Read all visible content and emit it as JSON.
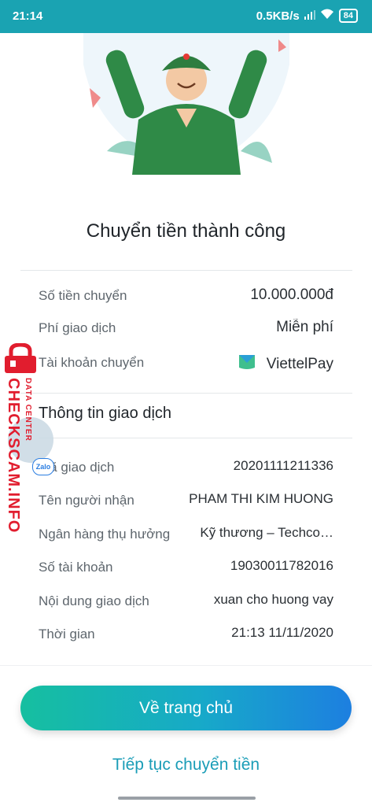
{
  "status_bar": {
    "time": "21:14",
    "network_speed": "0.5KB/s",
    "battery": "84"
  },
  "title": "Chuyển tiền thành công",
  "summary": [
    {
      "label": "Số tiền chuyển",
      "value": "10.000.000đ"
    },
    {
      "label": "Phí giao dịch",
      "value": "Miễn phí"
    },
    {
      "label": "Tài khoản chuyển",
      "value": "ViettelPay"
    }
  ],
  "details_title": "Thông tin giao dịch",
  "details": [
    {
      "label": "Mã giao dịch",
      "value": "20201111211336"
    },
    {
      "label": "Tên người nhận",
      "value": "PHAM THI KIM HUONG"
    },
    {
      "label": "Ngân hàng thụ hưởng",
      "value": "Kỹ thương – Techco…"
    },
    {
      "label": "Số tài khoản",
      "value": "19030011782016"
    },
    {
      "label": "Nội dung giao dịch",
      "value": "xuan cho huong vay"
    },
    {
      "label": "Thời gian",
      "value": "21:13 11/11/2020"
    }
  ],
  "buttons": {
    "home": "Về trang chủ",
    "continue": "Tiếp tục chuyển tiền"
  },
  "watermark": {
    "text": "CHECKSCAM.INFO",
    "subtext": "DATA CENTER",
    "zalo": "Zalo"
  },
  "icons": {
    "wifi": "wifi-icon",
    "signal": "signal-icon",
    "wallet": "viettelpay-icon"
  },
  "colors": {
    "statusbar": "#1aa3b2",
    "accent": "#1a9db7",
    "button_start": "#16bfa0",
    "button_end": "#1d7fe0"
  }
}
